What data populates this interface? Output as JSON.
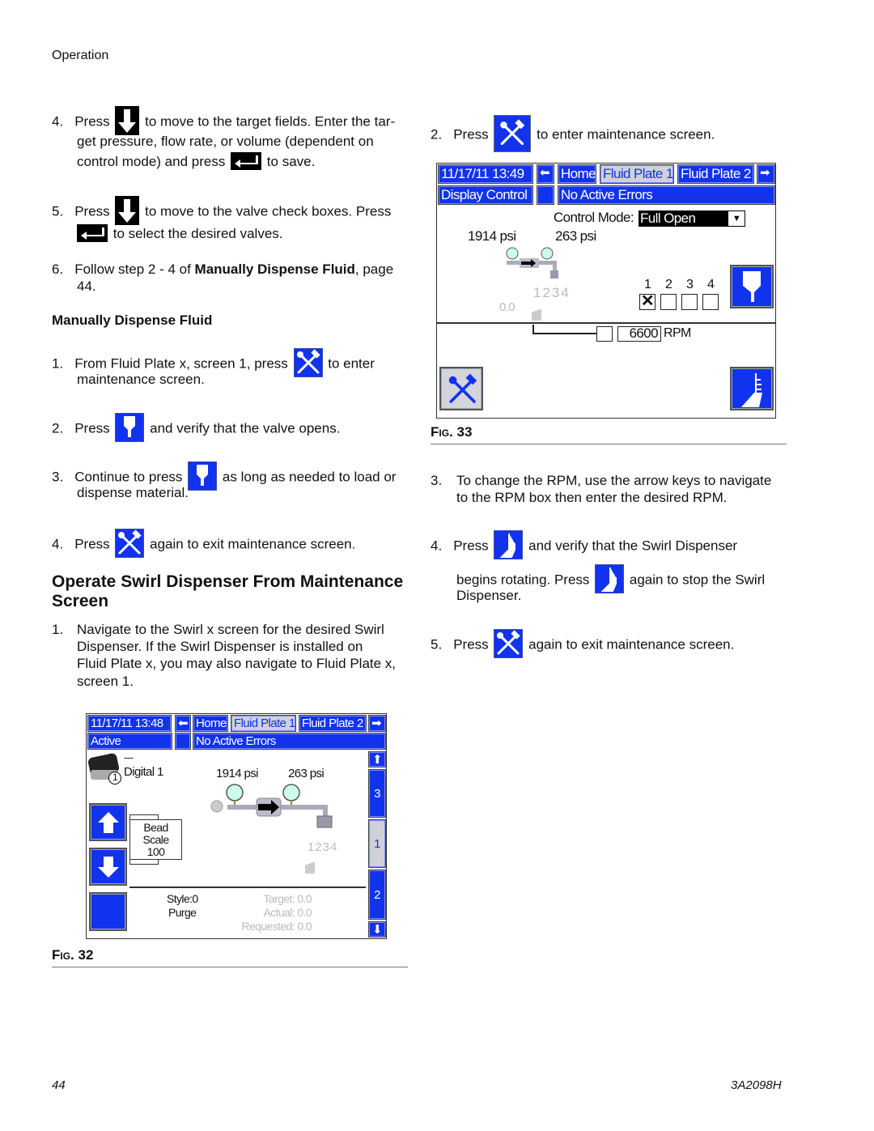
{
  "header": {
    "section": "Operation"
  },
  "left": {
    "step4": {
      "num": "4.",
      "press": "Press",
      "l1": "to move to the target fields. Enter the tar-",
      "l2": "get pressure, flow rate, or volume (dependent on",
      "l3a": "control mode) and press",
      "l3b": "to save."
    },
    "step5": {
      "num": "5.",
      "press": "Press",
      "l1": "to move to the valve check boxes. Press",
      "l2": "to select the desired valves."
    },
    "step6": {
      "num": "6.",
      "l1a": "Follow step 2 - 4 of ",
      "l1b": "Manually Dispense Fluid",
      "l1c": ", page",
      "l2": "44."
    },
    "subheading": "Manually Dispense Fluid",
    "md1": {
      "num": "1.",
      "a": "From Fluid Plate x, screen 1, press",
      "b": "to enter",
      "l2": "maintenance screen."
    },
    "md2": {
      "num": "2.",
      "a": "Press",
      "b": "and verify that the valve opens."
    },
    "md3": {
      "num": "3.",
      "a": "Continue to press",
      "b": "as long as needed to load or",
      "l2": "dispense material."
    },
    "md4": {
      "num": "4.",
      "a": "Press",
      "b": "again to exit maintenance screen."
    },
    "heading": [
      "Operate Swirl Dispenser From Maintenance",
      "Screen"
    ],
    "sw1": {
      "num": "1.",
      "lines": [
        "Navigate to the Swirl x screen for the desired Swirl",
        "Dispenser. If the Swirl Dispenser is installed on",
        "Fluid Plate x, you may also navigate to Fluid Plate x,",
        "screen 1."
      ]
    },
    "fig_label": "Fig.",
    "fig_num": "32"
  },
  "right": {
    "s2": {
      "num": "2.",
      "a": "Press",
      "b": "to enter maintenance screen."
    },
    "fig_label": "Fig.",
    "fig_num": "33",
    "s3": {
      "num": "3.",
      "l1": "To change the RPM, use the arrow keys to navigate",
      "l2": "to the RPM box then enter the desired RPM."
    },
    "s4": {
      "num": "4.",
      "a": "Press",
      "b": "and verify that the Swirl Dispenser",
      "c": "begins rotating. Press",
      "d": "again to stop the Swirl",
      "e": "Dispenser."
    },
    "s5": {
      "num": "5.",
      "a": "Press",
      "b": "again to exit maintenance screen."
    }
  },
  "fig33": {
    "datetime": "11/17/11 13:49",
    "tabs": [
      "Home",
      "Fluid Plate 1",
      "Fluid Plate 2"
    ],
    "active_tab": "Fluid Plate 1",
    "status_left": "Display Control",
    "status": "No Active Errors",
    "control_mode_label": "Control Mode:",
    "control_mode": "Full Open",
    "p1": "1914 psi",
    "p2": "263 psi",
    "valves_label": "1234",
    "flow": "0.0",
    "valve_nums": [
      "1",
      "2",
      "3",
      "4"
    ],
    "valve_checked": [
      true,
      false,
      false,
      false
    ],
    "rpm": "6600",
    "rpm_unit": "RPM"
  },
  "fig32": {
    "datetime": "11/17/11 13:48",
    "tabs": [
      "Home",
      "Fluid Plate 1",
      "Fluid Plate 2"
    ],
    "active_tab": "Fluid Plate 1",
    "status_left": "Active",
    "status": "No Active Errors",
    "device_line1": "---",
    "device_name": "Digital 1",
    "device_num": "1",
    "p1": "1914 psi",
    "p2": "263 psi",
    "valves_label": "1234",
    "bead": [
      "Bead",
      "Scale",
      "100"
    ],
    "style": "Style:0",
    "mode": "Purge",
    "target": "Target: 0.0",
    "actual": "Actual: 0.0",
    "requested": "Requested: 0.0",
    "side_tabs": [
      "3",
      "1",
      "2"
    ],
    "active_side_tab": "1"
  },
  "colors": {
    "screen_blue": "#1133ee",
    "selected_tab": "#d0d0d8"
  },
  "footer": {
    "page": "44",
    "doc": "3A2098H"
  }
}
